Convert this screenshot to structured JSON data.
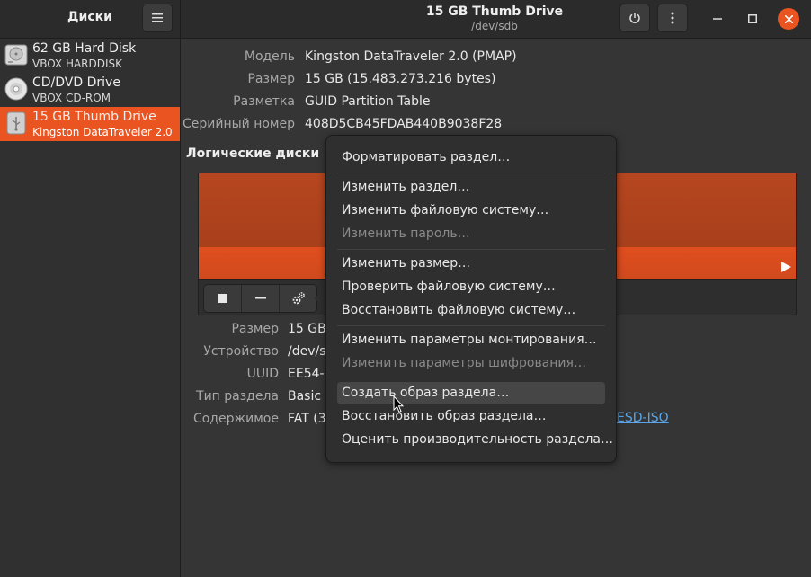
{
  "app": {
    "title": "Диски"
  },
  "window": {
    "title": "15 GB Thumb Drive",
    "subtitle": "/dev/sdb"
  },
  "sidebar": {
    "drives": [
      {
        "name": "62 GB Hard Disk",
        "model": "VBOX HARDDISK",
        "icon": "hard-disk-icon",
        "selected": false
      },
      {
        "name": "CD/DVD Drive",
        "model": "VBOX CD-ROM",
        "icon": "optical-drive-icon",
        "selected": false
      },
      {
        "name": "15 GB Thumb Drive",
        "model": "Kingston DataTraveler 2.0",
        "icon": "usb-drive-icon",
        "selected": true
      }
    ]
  },
  "disk_info": {
    "model_label": "Модель",
    "model_value": "Kingston DataTraveler 2.0 (PMAP)",
    "size_label": "Размер",
    "size_value": "15 GB (15.483.273.216 bytes)",
    "partitioning_label": "Разметка",
    "partitioning_value": "GUID Partition Table",
    "serial_label": "Серийный номер",
    "serial_value": "408D5CB45FDAB440B9038F28"
  },
  "volumes": {
    "section_title": "Логические диски"
  },
  "partition_info": {
    "size_label": "Размер",
    "size_value": "15 GB",
    "device_label": "Устройство",
    "device_value": "/dev/s",
    "uuid_label": "UUID",
    "uuid_value": "EE54-8",
    "type_label": "Тип раздела",
    "type_value": "Basic I",
    "contents_label": "Содержимое",
    "contents_value": "FAT (3",
    "contents_link": "ESD-ISO"
  },
  "context_menu": {
    "format": "Форматировать раздел…",
    "edit_partition": "Изменить раздел…",
    "edit_filesystem": "Изменить файловую систему…",
    "change_passphrase": "Изменить пароль…",
    "resize": "Изменить размер…",
    "check_fs": "Проверить файловую систему…",
    "repair_fs": "Восстановить файловую систему…",
    "mount_options": "Изменить параметры монтирования…",
    "encryption_options": "Изменить параметры шифрования…",
    "create_image": "Создать образ раздела…",
    "restore_image": "Восстановить образ раздела…",
    "benchmark": "Оценить производительность раздела…"
  },
  "colors": {
    "accent": "#e95420",
    "volume_bar": "#c84a20",
    "link": "#5aa6e6"
  }
}
